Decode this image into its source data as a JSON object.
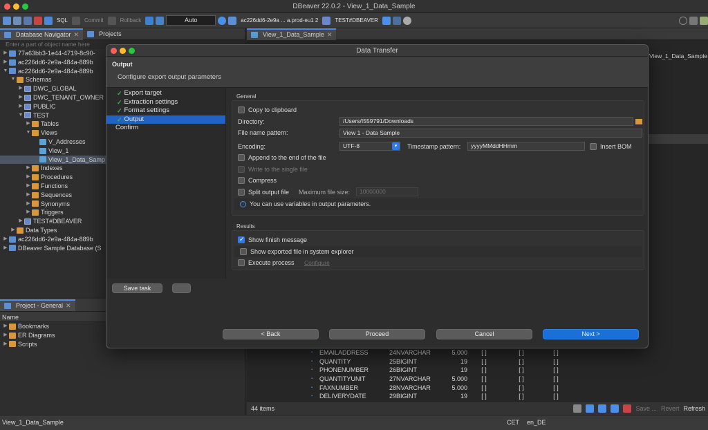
{
  "app": {
    "window_title": "DBeaver 22.0.2 - View_1_Data_Sample"
  },
  "toolbar": {
    "sql_label": "SQL",
    "commit_label": "Commit",
    "rollback_label": "Rollback",
    "tx_mode": "Auto",
    "connection_label": "ac226dd6-2e9a ... a.prod-eu1 2",
    "schema_label": "TEST#DBEAVER"
  },
  "navigator": {
    "tab_label": "Database Navigator",
    "projects_tab_label": "Projects",
    "filter_placeholder": "Enter a part of object name here",
    "items": [
      {
        "label": "77a63bb3-1e44-4719-8c90-",
        "depth": 0,
        "icon": "database-icon"
      },
      {
        "label": "ac226dd6-2e9a-484a-889b",
        "depth": 0,
        "icon": "database-icon"
      },
      {
        "label": "ac226dd6-2e9a-484a-889b",
        "depth": 0,
        "icon": "database-icon"
      },
      {
        "label": "Schemas",
        "depth": 1,
        "icon": "folder-icon"
      },
      {
        "label": "DWC_GLOBAL",
        "depth": 2,
        "icon": "schema-icon"
      },
      {
        "label": "DWC_TENANT_OWNER",
        "depth": 2,
        "icon": "schema-icon"
      },
      {
        "label": "PUBLIC",
        "depth": 2,
        "icon": "schema-icon"
      },
      {
        "label": "TEST",
        "depth": 2,
        "icon": "schema-icon"
      },
      {
        "label": "Tables",
        "depth": 3,
        "icon": "folder-icon"
      },
      {
        "label": "Views",
        "depth": 3,
        "icon": "folder-icon"
      },
      {
        "label": "V_Addresses",
        "depth": 4,
        "icon": "view-icon"
      },
      {
        "label": "View_1",
        "depth": 4,
        "icon": "view-icon"
      },
      {
        "label": "View_1_Data_Samp",
        "depth": 4,
        "icon": "view-icon"
      },
      {
        "label": "Indexes",
        "depth": 3,
        "icon": "folder-icon"
      },
      {
        "label": "Procedures",
        "depth": 3,
        "icon": "folder-icon"
      },
      {
        "label": "Functions",
        "depth": 3,
        "icon": "folder-icon"
      },
      {
        "label": "Sequences",
        "depth": 3,
        "icon": "folder-icon"
      },
      {
        "label": "Synonyms",
        "depth": 3,
        "icon": "folder-icon"
      },
      {
        "label": "Triggers",
        "depth": 3,
        "icon": "folder-icon"
      },
      {
        "label": "TEST#DBEAVER",
        "depth": 2,
        "icon": "schema-icon"
      },
      {
        "label": "Data Types",
        "depth": 1,
        "icon": "folder-icon"
      },
      {
        "label": "ac226dd6-2e9a-484a-889b",
        "depth": 0,
        "icon": "database-icon"
      },
      {
        "label": "DBeaver Sample Database (S",
        "depth": 0,
        "icon": "database-icon"
      }
    ]
  },
  "project": {
    "tab_label": "Project - General",
    "column_header": "Name",
    "items": [
      "Bookmarks",
      "ER Diagrams",
      "Scripts"
    ]
  },
  "editor": {
    "tab_label": "View_1_Data_Sample",
    "right_label": "View_1_Data_Sample",
    "rows": [
      {
        "name": "EMAILADDRESS",
        "num": "24",
        "type": "NVARCHAR",
        "len": "5.000",
        "a": "[ ]",
        "b": "[ ]",
        "c": "[ ]"
      },
      {
        "name": "QUANTITY",
        "num": "25",
        "type": "BIGINT",
        "len": "19",
        "a": "[ ]",
        "b": "[ ]",
        "c": "[ ]"
      },
      {
        "name": "PHONENUMBER",
        "num": "26",
        "type": "BIGINT",
        "len": "19",
        "a": "[ ]",
        "b": "[ ]",
        "c": "[ ]"
      },
      {
        "name": "QUANTITYUNIT",
        "num": "27",
        "type": "NVARCHAR",
        "len": "5.000",
        "a": "[ ]",
        "b": "[ ]",
        "c": "[ ]"
      },
      {
        "name": "FAXNUMBER",
        "num": "28",
        "type": "NVARCHAR",
        "len": "5.000",
        "a": "[ ]",
        "b": "[ ]",
        "c": "[ ]"
      },
      {
        "name": "DELIVERYDATE",
        "num": "29",
        "type": "BIGINT",
        "len": "19",
        "a": "[ ]",
        "b": "[ ]",
        "c": "[ ]"
      }
    ],
    "items_count": "44 items",
    "save_label": "Save ...",
    "revert_label": "Revert",
    "refresh_label": "Refresh"
  },
  "dialog": {
    "title": "Data Transfer",
    "header_title": "Output",
    "header_subtitle": "Configure export output parameters",
    "steps": [
      "Export target",
      "Extraction settings",
      "Format settings",
      "Output",
      "Confirm"
    ],
    "save_task_label": "Save task",
    "general_label": "General",
    "copy_clipboard_label": "Copy to clipboard",
    "directory_label": "Directory:",
    "directory_value": "/Users/I559791/Downloads",
    "file_name_pattern_label": "File name pattern:",
    "file_name_pattern_value": "View 1 - Data Sample",
    "encoding_label": "Encoding:",
    "encoding_value": "UTF-8",
    "timestamp_label": "Timestamp pattern:",
    "timestamp_value": "yyyyMMddHHmm",
    "insert_bom_label": "Insert BOM",
    "append_label": "Append to the end of the file",
    "single_file_label": "Write to the single file",
    "compress_label": "Compress",
    "split_label": "Split output file",
    "max_size_label": "Maximum file size:",
    "max_size_value": "10000000",
    "info_text": "You can use variables in output parameters.",
    "results_label": "Results",
    "finish_msg_label": "Show finish message",
    "explorer_label": "Show exported file in system explorer",
    "exec_process_label": "Execute process",
    "configure_label": "Configure",
    "back_label": "< Back",
    "proceed_label": "Proceed",
    "cancel_label": "Cancel",
    "next_label": "Next >"
  },
  "status": {
    "left": "View_1_Data_Sample",
    "tz": "CET",
    "locale": "en_DE"
  },
  "colors": {
    "accent": "#1a6fd8",
    "check": "#3fb14a",
    "folder": "#d9963a"
  }
}
